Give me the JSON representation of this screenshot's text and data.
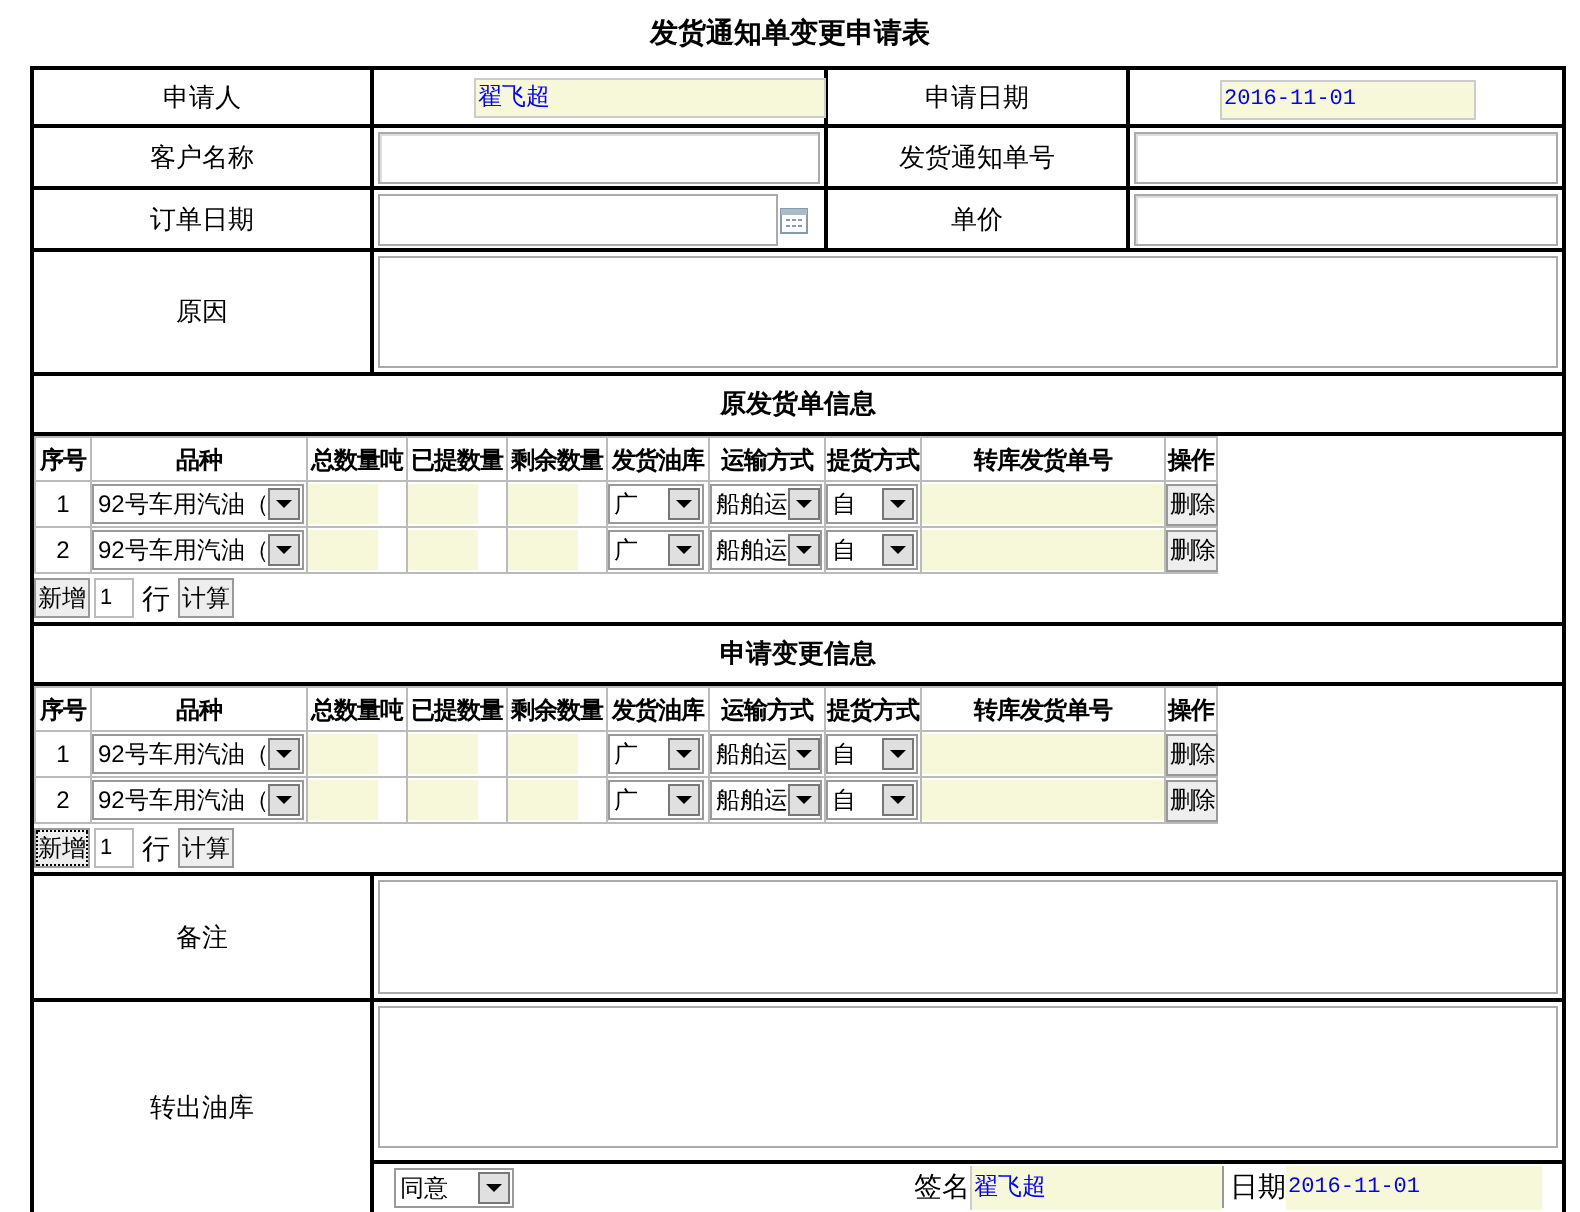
{
  "title": "发货通知单变更申请表",
  "fields": [
    {
      "label": "申请人",
      "value": "翟飞超",
      "kind": "filled"
    },
    {
      "label": "申请日期",
      "value": "2016-11-01",
      "kind": "filled-date"
    },
    {
      "label": "客户名称",
      "kind": "empty"
    },
    {
      "label": "发货通知单号",
      "kind": "empty"
    },
    {
      "label": "订单日期",
      "kind": "date-picker"
    },
    {
      "label": "单价",
      "kind": "empty"
    }
  ],
  "reason": {
    "label": "原因"
  },
  "sections": [
    {
      "title": "原发货单信息",
      "columns": [
        "序号",
        "品种",
        "总数量吨",
        "已提数量",
        "剩余数量",
        "发货油库",
        "运输方式",
        "提货方式",
        "转库发货单号",
        "操作"
      ],
      "rows": [
        {
          "index": "1",
          "product": "92号车用汽油（",
          "depot": "广",
          "transport": "船舶运",
          "pickup": "自",
          "action": "删除"
        },
        {
          "index": "2",
          "product": "92号车用汽油（",
          "depot": "广",
          "transport": "船舶运",
          "pickup": "自",
          "action": "删除"
        }
      ],
      "footer": {
        "add": "新增",
        "add_focused": false,
        "count": "1",
        "unit": "行",
        "calc": "计算"
      }
    },
    {
      "title": "申请变更信息",
      "columns": [
        "序号",
        "品种",
        "总数量吨",
        "已提数量",
        "剩余数量",
        "发货油库",
        "运输方式",
        "提货方式",
        "转库发货单号",
        "操作"
      ],
      "rows": [
        {
          "index": "1",
          "product": "92号车用汽油（",
          "depot": "广",
          "transport": "船舶运",
          "pickup": "自",
          "action": "删除"
        },
        {
          "index": "2",
          "product": "92号车用汽油（",
          "depot": "广",
          "transport": "船舶运",
          "pickup": "自",
          "action": "删除"
        }
      ],
      "footer": {
        "add": "新增",
        "add_focused": true,
        "count": "1",
        "unit": "行",
        "calc": "计算"
      }
    }
  ],
  "remarks": {
    "label": "备注"
  },
  "transfer": {
    "label": "转出油库",
    "approval": "同意",
    "signature_label": "签名",
    "signature": "翟飞超",
    "date_label": "日期",
    "date": "2016-11-01"
  }
}
